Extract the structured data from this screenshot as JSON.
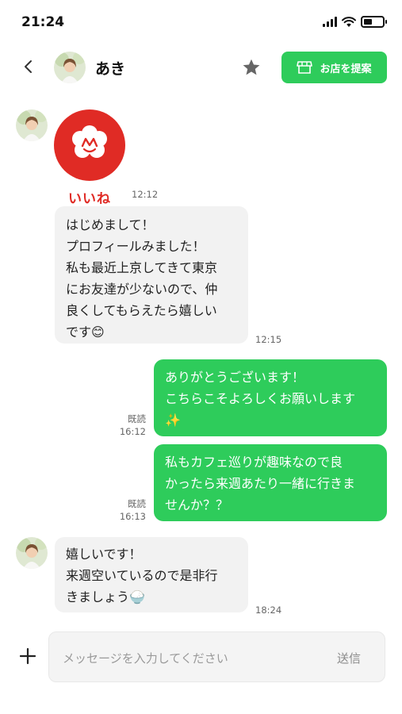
{
  "status_bar": {
    "time": "21:24"
  },
  "header": {
    "contact_name": "あき",
    "propose_button": "お店を提案"
  },
  "colors": {
    "accent_green": "#2ecc5b",
    "like_red": "#e02b25"
  },
  "messages": [
    {
      "id": "like",
      "side": "in",
      "type": "stamp",
      "stamp_text": "いいね",
      "time": "12:12"
    },
    {
      "id": "m1",
      "side": "in",
      "lines": [
        "はじめまして！",
        "プロフィールみました！",
        "私も最近上京してきて東京",
        "にお友達が少ないので、仲",
        "良くしてもらえたら嬉しい",
        "です😊"
      ],
      "time": "12:15"
    },
    {
      "id": "m2",
      "side": "out",
      "read": "既読",
      "lines": [
        "ありがとうございます！",
        "こちらこそよろしくお願いします",
        "✨"
      ],
      "time": "16:12"
    },
    {
      "id": "m3",
      "side": "out",
      "read": "既読",
      "lines": [
        "私もカフェ巡りが趣味なので良",
        "かったら来週あたり一緒に行きま",
        "せんか？？"
      ],
      "time": "16:13"
    },
    {
      "id": "m4",
      "side": "in",
      "lines": [
        "嬉しいです！",
        "来週空いているので是非行",
        "きましょう🍚"
      ],
      "time": "18:24"
    }
  ],
  "input": {
    "placeholder": "メッセージを入力してください",
    "send_label": "送信"
  }
}
